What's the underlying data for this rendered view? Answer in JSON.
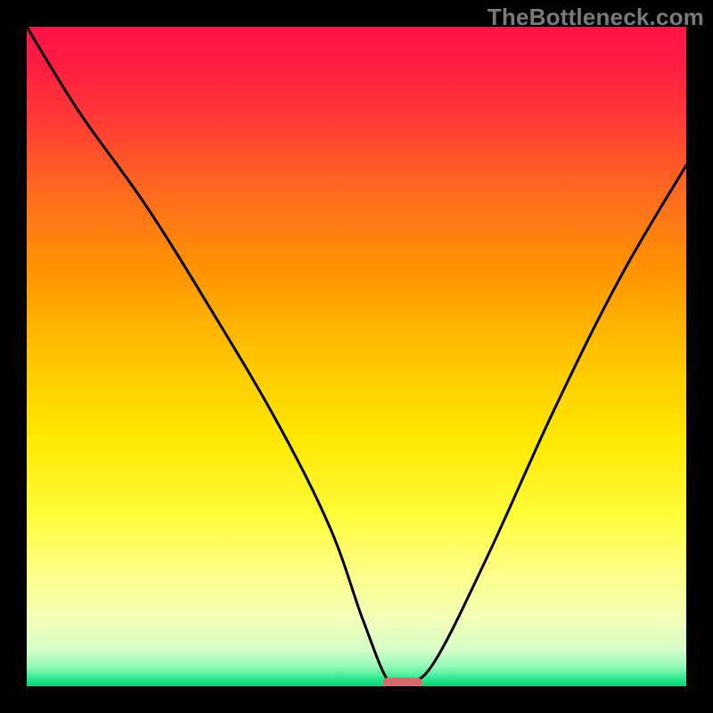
{
  "watermark": "TheBottleneck.com",
  "chart_data": {
    "type": "line",
    "title": "",
    "xlabel": "",
    "ylabel": "",
    "xlim": [
      0,
      100
    ],
    "ylim": [
      0,
      100
    ],
    "grid": false,
    "legend": false,
    "series": [
      {
        "name": "bottleneck-curve",
        "x": [
          0,
          8,
          18,
          28,
          38,
          46,
          51,
          55,
          58,
          62,
          70,
          80,
          90,
          100
        ],
        "values": [
          100,
          87,
          73,
          57,
          40,
          24,
          10,
          0.5,
          0.5,
          4,
          20,
          42,
          62,
          79
        ]
      }
    ],
    "marker": {
      "name": "optimal-zone",
      "x_range": [
        54,
        60
      ],
      "y": 0.5,
      "color": "#d46a6a"
    },
    "gradient_stops": [
      {
        "offset": 0.0,
        "color": "#ff1345"
      },
      {
        "offset": 0.06,
        "color": "#ff1d42"
      },
      {
        "offset": 0.14,
        "color": "#ff3a36"
      },
      {
        "offset": 0.25,
        "color": "#ff6a20"
      },
      {
        "offset": 0.37,
        "color": "#ff9400"
      },
      {
        "offset": 0.5,
        "color": "#ffc400"
      },
      {
        "offset": 0.62,
        "color": "#ffe700"
      },
      {
        "offset": 0.74,
        "color": "#fffc3a"
      },
      {
        "offset": 0.83,
        "color": "#fcff8a"
      },
      {
        "offset": 0.9,
        "color": "#f2ffb8"
      },
      {
        "offset": 0.945,
        "color": "#d6ffc8"
      },
      {
        "offset": 0.972,
        "color": "#8cf7b5"
      },
      {
        "offset": 0.99,
        "color": "#27e48c"
      },
      {
        "offset": 1.0,
        "color": "#00d876"
      }
    ]
  }
}
